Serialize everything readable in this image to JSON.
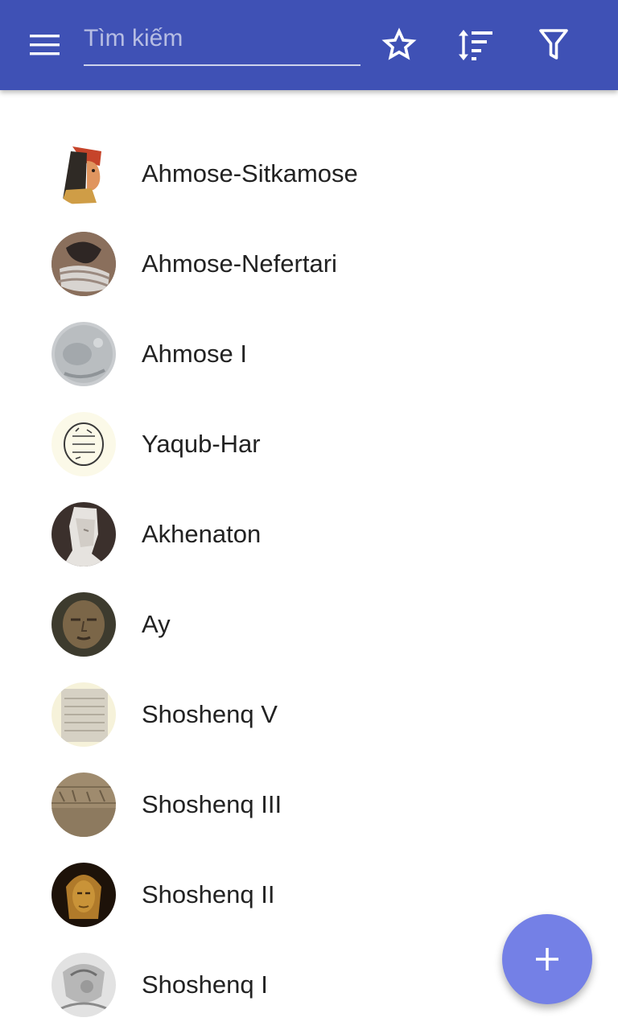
{
  "toolbar": {
    "menu_icon": "hamburger-menu-icon",
    "search_placeholder": "Tìm kiếm",
    "search_value": "",
    "favorite_icon": "star-outline-icon",
    "sort_icon": "sort-icon",
    "filter_icon": "filter-icon",
    "color": "#3f51b5"
  },
  "list": {
    "items": [
      {
        "label": "Ahmose-Sitkamose"
      },
      {
        "label": "Ahmose-Nefertari"
      },
      {
        "label": "Ahmose I"
      },
      {
        "label": "Yaqub-Har"
      },
      {
        "label": "Akhenaton"
      },
      {
        "label": "Ay"
      },
      {
        "label": "Shoshenq V"
      },
      {
        "label": "Shoshenq III"
      },
      {
        "label": "Shoshenq II"
      },
      {
        "label": "Shoshenq I"
      }
    ]
  },
  "fab": {
    "icon": "plus-icon",
    "color": "#7480e6"
  }
}
